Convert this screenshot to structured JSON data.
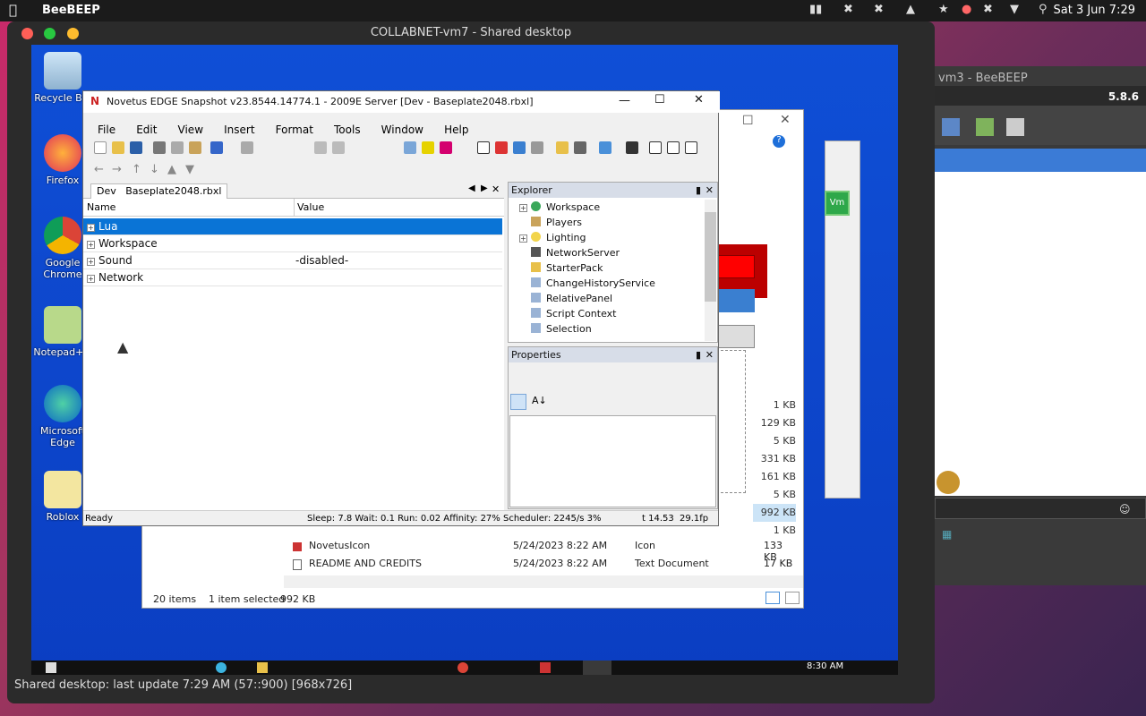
{
  "mac": {
    "app_name": "BeeBEEP",
    "clock": "Sat 3 Jun 7:29"
  },
  "viewer": {
    "title": "COLLABNET-vm7 - Shared desktop",
    "status": "Shared desktop: last update 7:29 AM (57::900) [968x726]"
  },
  "vm3": {
    "title": "vm3 - BeeBEEP",
    "version": "5.8.6"
  },
  "desktop_icons": [
    {
      "label": "Recycle Bin"
    },
    {
      "label": "Firefox"
    },
    {
      "label": "Google Chrome"
    },
    {
      "label": "Notepad++"
    },
    {
      "label": "Microsoft Edge"
    },
    {
      "label": "Roblox"
    }
  ],
  "taskbar": {
    "time": "8:30 AM"
  },
  "explorer_bg": {
    "files": [
      {
        "name": "NovetusIcon",
        "date": "5/24/2023 8:22 AM",
        "type": "Icon",
        "size": "133 KB"
      },
      {
        "name": "README AND CREDITS",
        "date": "5/24/2023 8:22 AM",
        "type": "Text Document",
        "size": "17 KB"
      }
    ],
    "sizes": [
      "1 KB",
      "129 KB",
      "5 KB",
      "331 KB",
      "161 KB",
      "5 KB",
      "992 KB",
      "1 KB"
    ],
    "items_count": "20 items",
    "selected": "1 item selected",
    "selected_size": "992 KB"
  },
  "studio": {
    "title": "Novetus EDGE Snapshot v23.8544.14774.1 - 2009E Server [Dev - Baseplate2048.rbxl]",
    "menu": [
      "File",
      "Edit",
      "View",
      "Insert",
      "Format",
      "Tools",
      "Window",
      "Help"
    ],
    "tab_label": "Dev",
    "tab_file": "Baseplate2048.rbxl",
    "col_name": "Name",
    "col_value": "Value",
    "rows": [
      {
        "name": "Lua",
        "value": ""
      },
      {
        "name": "Workspace",
        "value": ""
      },
      {
        "name": "Sound",
        "value": "-disabled-"
      },
      {
        "name": "Network",
        "value": ""
      }
    ],
    "explorer_title": "Explorer",
    "explorer_items": [
      "Workspace",
      "Players",
      "Lighting",
      "NetworkServer",
      "StarterPack",
      "ChangeHistoryService",
      "RelativePanel",
      "Script Context",
      "Selection"
    ],
    "properties_title": "Properties",
    "status_ready": "Ready",
    "status_perf": "Sleep: 7.8 Wait: 0.1 Run: 0.02 Affinity: 27% Scheduler: 2245/s 3%",
    "status_time": "t 14.53",
    "status_fps": "29.1fp"
  }
}
